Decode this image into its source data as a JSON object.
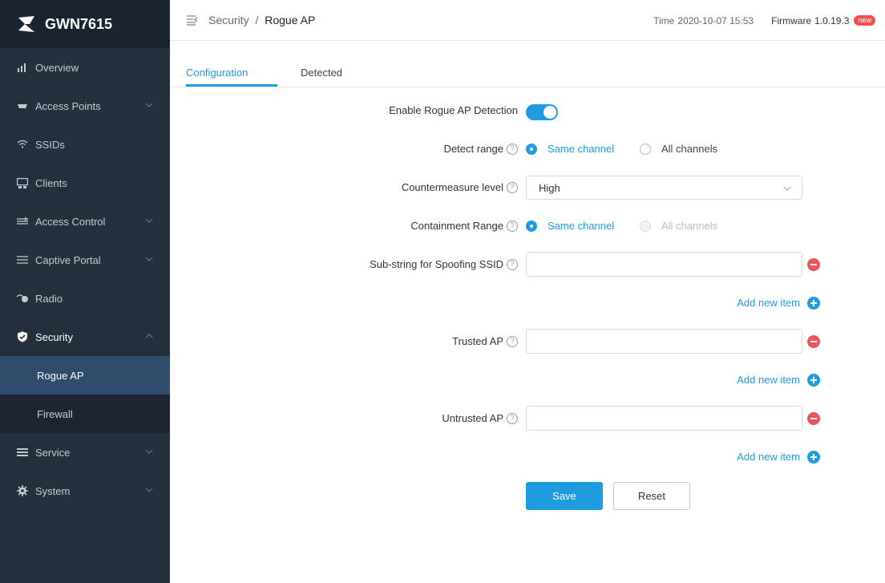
{
  "app": {
    "title": "GWN7615"
  },
  "sidebar": {
    "items": [
      {
        "label": "Overview",
        "icon": "bar-chart-icon"
      },
      {
        "label": "Access Points",
        "icon": "access-point-icon"
      },
      {
        "label": "SSIDs",
        "icon": "wifi-icon"
      },
      {
        "label": "Clients",
        "icon": "clients-icon"
      },
      {
        "label": "Access Control",
        "icon": "access-control-icon"
      },
      {
        "label": "Captive Portal",
        "icon": "captive-portal-icon"
      },
      {
        "label": "Radio",
        "icon": "radio-icon"
      },
      {
        "label": "Security",
        "icon": "shield-icon"
      },
      {
        "label": "Service",
        "icon": "service-icon"
      },
      {
        "label": "System",
        "icon": "gear-icon"
      }
    ],
    "security_sub": [
      {
        "label": "Rogue AP"
      },
      {
        "label": "Firewall"
      }
    ]
  },
  "header": {
    "breadcrumb_parent": "Security",
    "breadcrumb_sep": "/",
    "breadcrumb_current": "Rogue AP",
    "time_label": "Time",
    "time_value": "2020-10-07 15:53",
    "firmware_label": "Firmware",
    "firmware_value": "1.0.19.3",
    "badge": "new"
  },
  "tabs": [
    {
      "label": "Configuration"
    },
    {
      "label": "Detected"
    }
  ],
  "form": {
    "enable_label": "Enable Rogue AP Detection",
    "enable_value": true,
    "detect_range_label": "Detect range",
    "detect_range_options": [
      "Same channel",
      "All channels"
    ],
    "countermeasure_label": "Countermeasure level",
    "countermeasure_value": "High",
    "containment_label": "Containment Range",
    "containment_options": [
      "Same channel",
      "All channels"
    ],
    "spoofing_label": "Sub-string for Spoofing SSID",
    "trusted_label": "Trusted AP",
    "untrusted_label": "Untrusted AP",
    "add_new_item": "Add new item",
    "help_glyph": "?",
    "save_label": "Save",
    "reset_label": "Reset"
  },
  "colors": {
    "accent": "#1f9be0",
    "danger": "#e9565b",
    "sidebar_bg": "#25303f",
    "sidebar_active": "#2f4c6c"
  }
}
